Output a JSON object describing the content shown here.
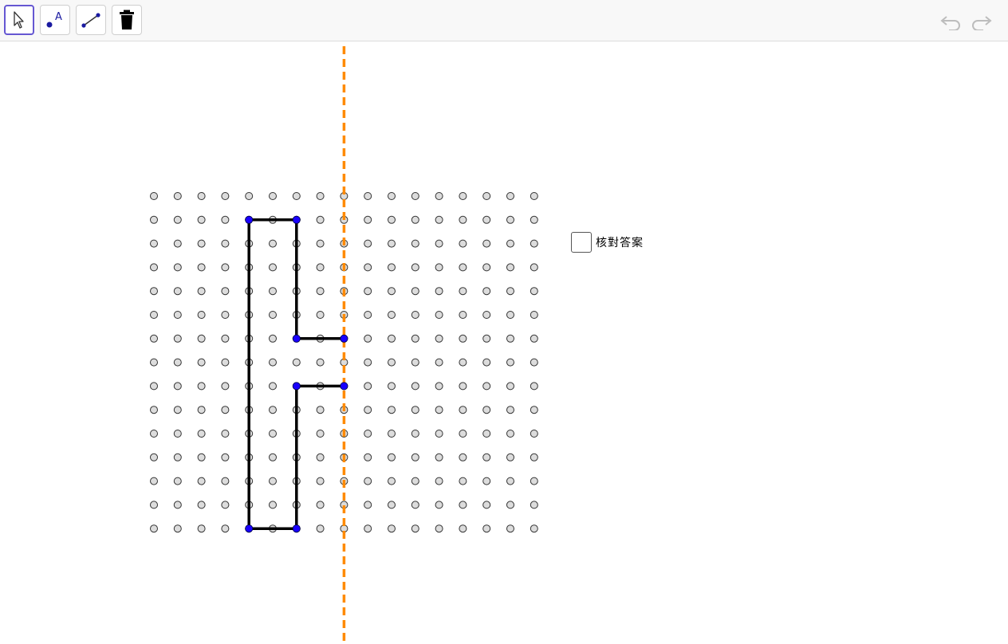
{
  "app": "GeoGebra",
  "toolbar": {
    "tools": [
      {
        "name": "move-tool",
        "icon": "cursor-arrow-icon",
        "active": true
      },
      {
        "name": "point-tool",
        "icon": "point-icon",
        "active": false
      },
      {
        "name": "segment-tool",
        "icon": "segment-icon",
        "active": false
      },
      {
        "name": "delete-tool",
        "icon": "trash-icon",
        "active": false
      }
    ],
    "undo_icon": "undo-icon",
    "redo_icon": "redo-icon"
  },
  "grid": {
    "cols": 17,
    "rows": 15,
    "dot_fill": "#dcdcdc",
    "dot_stroke": "#333333"
  },
  "axis_of_symmetry": {
    "col": 8,
    "color": "#ff8a00",
    "style": "dashed"
  },
  "shape": {
    "color": "#000000",
    "vertex_color": "#1a00ff",
    "vertices": [
      [
        4,
        1
      ],
      [
        6,
        1
      ],
      [
        6,
        6
      ],
      [
        8,
        6
      ],
      [
        8,
        8
      ],
      [
        6,
        8
      ],
      [
        6,
        14
      ],
      [
        4,
        14
      ]
    ],
    "open_segments": [
      [
        [
          4,
          1
        ],
        [
          6,
          1
        ]
      ],
      [
        [
          6,
          1
        ],
        [
          6,
          6
        ]
      ],
      [
        [
          6,
          6
        ],
        [
          8,
          6
        ]
      ],
      [
        [
          8,
          8
        ],
        [
          6,
          8
        ]
      ],
      [
        [
          6,
          8
        ],
        [
          6,
          14
        ]
      ],
      [
        [
          6,
          14
        ],
        [
          4,
          14
        ]
      ],
      [
        [
          4,
          14
        ],
        [
          4,
          1
        ]
      ]
    ]
  },
  "checkbox": {
    "label": "核對答案",
    "checked": false
  }
}
